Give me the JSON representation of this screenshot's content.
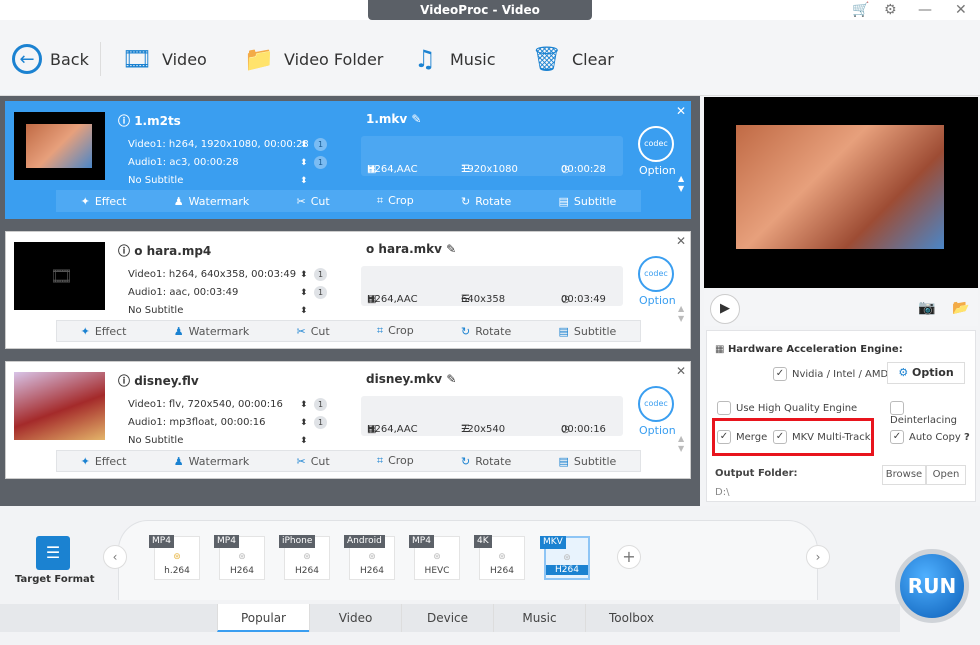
{
  "window": {
    "title": "VideoProc - Video"
  },
  "toolbar": {
    "back": "Back",
    "video": "Video",
    "video_folder": "Video Folder",
    "music": "Music",
    "clear": "Clear"
  },
  "items": [
    {
      "input": "1.m2ts",
      "video": "Video1: h264, 1920x1080, 00:00:28",
      "audio": "Audio1: ac3, 00:00:28",
      "subtitle": "No Subtitle",
      "video_track": "1",
      "audio_track": "1",
      "output": "1.mkv",
      "codec": "H264,AAC",
      "resolution": "1920x1080",
      "duration": "00:00:28",
      "option": "Option",
      "codec_icon": "codec",
      "selected": true
    },
    {
      "input": "o hara.mp4",
      "video": "Video1: h264, 640x358, 00:03:49",
      "audio": "Audio1: aac, 00:03:49",
      "subtitle": "No Subtitle",
      "video_track": "1",
      "audio_track": "1",
      "output": "o hara.mkv",
      "codec": "H264,AAC",
      "resolution": "640x358",
      "duration": "00:03:49",
      "option": "Option",
      "codec_icon": "codec",
      "selected": false
    },
    {
      "input": "disney.flv",
      "video": "Video1: flv, 720x540, 00:00:16",
      "audio": "Audio1: mp3float, 00:00:16",
      "subtitle": "No Subtitle",
      "video_track": "1",
      "audio_track": "1",
      "output": "disney.mkv",
      "codec": "H264,AAC",
      "resolution": "720x540",
      "duration": "00:00:16",
      "option": "Option",
      "codec_icon": "codec",
      "selected": false
    }
  ],
  "edit_tools": [
    "Effect",
    "Watermark",
    "Cut",
    "Crop",
    "Rotate",
    "Subtitle"
  ],
  "settings": {
    "hw_title": "Hardware Acceleration Engine:",
    "hw_vendor": "Nvidia / Intel / AMD",
    "hw_vendor_checked": true,
    "option": "Option",
    "high_quality": "Use High Quality Engine",
    "high_quality_checked": false,
    "deinterlacing": "Deinterlacing",
    "deinterlacing_checked": false,
    "merge": "Merge",
    "merge_checked": true,
    "mkv_multitrack": "MKV Multi-Track",
    "mkv_multitrack_checked": true,
    "auto_copy": "Auto Copy",
    "auto_copy_help": "?",
    "auto_copy_checked": true,
    "output_folder_label": "Output Folder:",
    "output_folder": "D:\\",
    "browse": "Browse",
    "open": "Open"
  },
  "target_format": {
    "label": "Target Format"
  },
  "formats": [
    {
      "tag": "MP4",
      "label": "h.264"
    },
    {
      "tag": "MP4",
      "label": "H264"
    },
    {
      "tag": "iPhone",
      "label": "H264"
    },
    {
      "tag": "Android",
      "label": "H264"
    },
    {
      "tag": "MP4",
      "label": "HEVC"
    },
    {
      "tag": "4K",
      "label": "H264"
    },
    {
      "tag": "MKV",
      "label": "H264",
      "selected": true
    }
  ],
  "tabs": [
    {
      "label": "Popular",
      "active": true
    },
    {
      "label": "Video"
    },
    {
      "label": "Device"
    },
    {
      "label": "Music"
    },
    {
      "label": "Toolbox"
    }
  ],
  "run": "RUN",
  "colors": {
    "accent": "#3a9ef0",
    "highlight_box": "#e8141d",
    "list_bg": "#5c6168"
  }
}
